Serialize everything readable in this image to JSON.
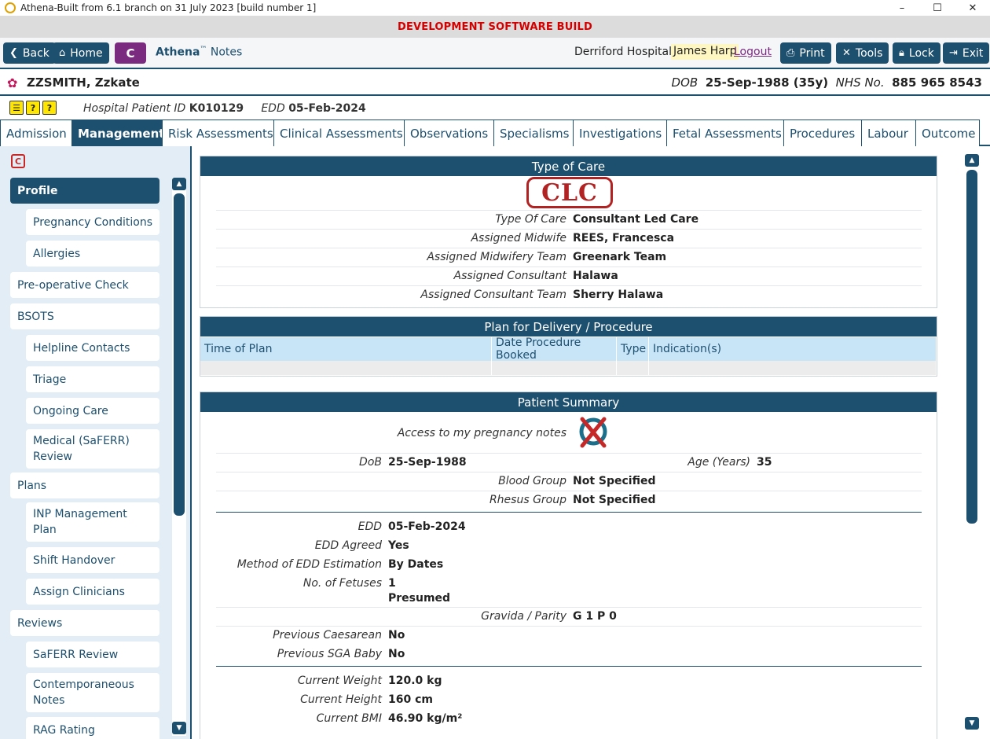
{
  "window": {
    "title": "Athena-Built from 6.1 branch on 31 July 2023 [build number 1]",
    "controls": {
      "minimize": "–",
      "maximize": "☐",
      "close": "✕"
    }
  },
  "banner": {
    "text": "DEVELOPMENT SOFTWARE BUILD",
    "color": "#d40000"
  },
  "toolbar": {
    "back": "Back",
    "home": "Home",
    "c": "C",
    "brand": "Athena",
    "tm": "™",
    "notes": "Notes",
    "hospital": "Derriford Hospital",
    "user": "James Harp",
    "logout": "Logout",
    "print": "Print",
    "tools": "Tools",
    "lock": "Lock",
    "exit": "Exit"
  },
  "patient": {
    "name": "ZZSMITH, Zzkate",
    "dob_label": "DOB",
    "dob": "25-Sep-1988 (35y)",
    "nhs_label": "NHS No.",
    "nhs": "885 965 8543",
    "hosp_id_label": "Hospital Patient ID",
    "hosp_id": "K010129",
    "edd_label": "EDD",
    "edd": "05-Feb-2024"
  },
  "tabs": [
    {
      "label": "Admission"
    },
    {
      "label": "Management"
    },
    {
      "label": "Risk Assessments"
    },
    {
      "label": "Clinical Assessments"
    },
    {
      "label": "Observations"
    },
    {
      "label": "Specialisms"
    },
    {
      "label": "Investigations"
    },
    {
      "label": "Fetal Assessments"
    },
    {
      "label": "Procedures"
    },
    {
      "label": "Labour"
    },
    {
      "label": "Outcome"
    }
  ],
  "sidebar": {
    "badge": "C",
    "items": [
      {
        "label": "Profile"
      },
      {
        "label": "Pregnancy Conditions"
      },
      {
        "label": "Allergies"
      },
      {
        "label": "Pre-operative Check"
      },
      {
        "label": "BSOTS"
      },
      {
        "label": "Helpline Contacts"
      },
      {
        "label": "Triage"
      },
      {
        "label": "Ongoing Care"
      },
      {
        "label": "Medical (SaFERR) Review"
      },
      {
        "label": "Plans"
      },
      {
        "label": "INP Management Plan"
      },
      {
        "label": "Shift Handover"
      },
      {
        "label": "Assign Clinicians"
      },
      {
        "label": "Reviews"
      },
      {
        "label": "SaFERR Review"
      },
      {
        "label": "Contemporaneous Notes"
      },
      {
        "label": "RAG Rating"
      }
    ]
  },
  "type_of_care": {
    "title": "Type of Care",
    "stamp": "CLC",
    "rows": [
      {
        "label": "Type Of Care",
        "value": "Consultant Led Care"
      },
      {
        "label": "Assigned Midwife",
        "value": "REES, Francesca"
      },
      {
        "label": "Assigned Midwifery Team",
        "value": "Greenark Team"
      },
      {
        "label": "Assigned Consultant",
        "value": "Halawa"
      },
      {
        "label": "Assigned Consultant Team",
        "value": "Sherry Halawa"
      }
    ]
  },
  "plan": {
    "title": "Plan for Delivery / Procedure",
    "columns": [
      "Time of Plan",
      "Date Procedure Booked",
      "Type",
      "Indication(s)"
    ]
  },
  "summary": {
    "title": "Patient Summary",
    "access_label": "Access to my pregnancy notes",
    "dob_label": "DoB",
    "dob": "25-Sep-1988",
    "age_label": "Age (Years)",
    "age": "35",
    "blood_label": "Blood Group",
    "blood": "Not Specified",
    "rhesus_label": "Rhesus Group",
    "rhesus": "Not Specified",
    "edd_label": "EDD",
    "edd": "05-Feb-2024",
    "edd_agreed_label": "EDD Agreed",
    "edd_agreed": "Yes",
    "method_label": "Method of EDD Estimation",
    "method": "By Dates",
    "fetuses_label": "No. of Fetuses",
    "fetuses": "1",
    "fetuses_note": "Presumed",
    "gravida_label": "Gravida / Parity",
    "gravida": "G 1 P 0",
    "caesarean_label": "Previous Caesarean",
    "caesarean": "No",
    "sga_label": "Previous SGA Baby",
    "sga": "No",
    "weight_label": "Current Weight",
    "weight": "120.0 kg",
    "height_label": "Current Height",
    "height": "160 cm",
    "bmi_label": "Current BMI",
    "bmi": "46.90 kg/m²"
  },
  "colors": {
    "primary": "#1d4f6f",
    "accent": "#7a2a7f",
    "alert": "#d40000"
  }
}
